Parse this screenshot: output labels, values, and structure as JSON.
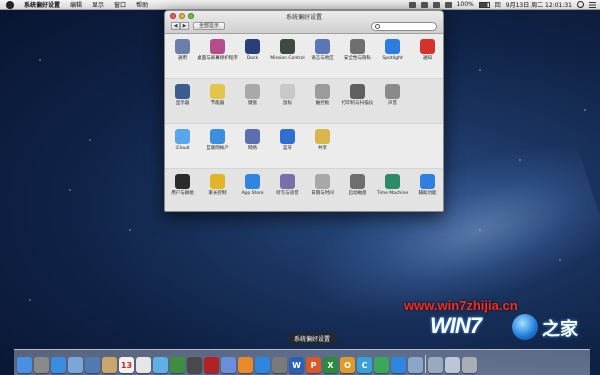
{
  "menubar": {
    "app_name": "系统偏好设置",
    "items": [
      "编辑",
      "显示",
      "窗口",
      "帮助"
    ],
    "battery": "100%",
    "clock": "9月13日 周二 12:01:31",
    "input_method": "回"
  },
  "window": {
    "title": "系统偏好设置",
    "show_all": "全部显示",
    "search_placeholder": "",
    "rows": [
      {
        "prefs": [
          {
            "label": "通用",
            "icon": "general-icon",
            "color": "#6b7da8"
          },
          {
            "label": "桌面与屏幕保护程序",
            "icon": "desktop-icon",
            "color": "#b54c8c"
          },
          {
            "label": "Dock",
            "icon": "dock-icon",
            "color": "#2a3f7a"
          },
          {
            "label": "Mission Control",
            "icon": "mission-control-icon",
            "color": "#3d4b3e"
          },
          {
            "label": "语言与地区",
            "icon": "language-region-icon",
            "color": "#5a76b8"
          },
          {
            "label": "安全性与隐私",
            "icon": "security-icon",
            "color": "#6f6f6f"
          },
          {
            "label": "Spotlight",
            "icon": "spotlight-icon",
            "color": "#2d7de0"
          },
          {
            "label": "通知",
            "icon": "notifications-icon",
            "color": "#d6322a"
          }
        ]
      },
      {
        "prefs": [
          {
            "label": "显示器",
            "icon": "display-icon",
            "color": "#3b5c8f"
          },
          {
            "label": "节能器",
            "icon": "energy-saver-icon",
            "color": "#e3c54a"
          },
          {
            "label": "键盘",
            "icon": "keyboard-icon",
            "color": "#a9a9a9"
          },
          {
            "label": "鼠标",
            "icon": "mouse-icon",
            "color": "#c8c8c8"
          },
          {
            "label": "触控板",
            "icon": "trackpad-icon",
            "color": "#9b9b9b"
          },
          {
            "label": "打印机与扫描仪",
            "icon": "printer-icon",
            "color": "#5f5f5f"
          },
          {
            "label": "声音",
            "icon": "sound-icon",
            "color": "#8a8a8a"
          }
        ]
      },
      {
        "prefs": [
          {
            "label": "iCloud",
            "icon": "icloud-icon",
            "color": "#5aa6ec"
          },
          {
            "label": "互联网帐户",
            "icon": "internet-accounts-icon",
            "color": "#3c8ee0"
          },
          {
            "label": "网络",
            "icon": "network-icon",
            "color": "#5b6fb0"
          },
          {
            "label": "蓝牙",
            "icon": "bluetooth-icon",
            "color": "#2f6fd0"
          },
          {
            "label": "共享",
            "icon": "sharing-icon",
            "color": "#d9b54a"
          }
        ]
      },
      {
        "prefs": [
          {
            "label": "用户与群组",
            "icon": "users-groups-icon",
            "color": "#2b2b2b"
          },
          {
            "label": "家长控制",
            "icon": "parental-controls-icon",
            "color": "#e0b526"
          },
          {
            "label": "App Store",
            "icon": "app-store-icon",
            "color": "#2f86e0"
          },
          {
            "label": "听写与语音",
            "icon": "dictation-speech-icon",
            "color": "#7a6fa8"
          },
          {
            "label": "日期与时间",
            "icon": "date-time-icon",
            "color": "#a8a8a8"
          },
          {
            "label": "启动磁盘",
            "icon": "startup-disk-icon",
            "color": "#6e6e6e"
          },
          {
            "label": "Time Machine",
            "icon": "time-machine-icon",
            "color": "#2f8a6a"
          },
          {
            "label": "辅助功能",
            "icon": "accessibility-icon",
            "color": "#2f7fe0"
          }
        ]
      }
    ]
  },
  "watermark": {
    "url": "www.win7zhijia.cn",
    "logo_text": "WIN7",
    "logo_suffix": "之家"
  },
  "dock": {
    "tooltip": "系统偏好设置",
    "icons": [
      {
        "name": "finder-icon",
        "color": "#4a90e2",
        "glyph": ""
      },
      {
        "name": "launchpad-icon",
        "color": "#8a8a8a",
        "glyph": ""
      },
      {
        "name": "safari-icon",
        "color": "#3a8de0",
        "glyph": ""
      },
      {
        "name": "mail-icon",
        "color": "#7aa6d8",
        "glyph": ""
      },
      {
        "name": "photo-icon",
        "color": "#4f7bb0",
        "glyph": ""
      },
      {
        "name": "notes-icon",
        "color": "#c9a66b",
        "glyph": ""
      },
      {
        "name": "calendar-icon",
        "color": "#f2f2f2",
        "glyph": "13"
      },
      {
        "name": "reminders-icon",
        "color": "#e6e6e6",
        "glyph": ""
      },
      {
        "name": "messages-icon",
        "color": "#5fb0e8",
        "glyph": ""
      },
      {
        "name": "facetime-icon",
        "color": "#3d8f3d",
        "glyph": ""
      },
      {
        "name": "camera-icon",
        "color": "#4a4a4a",
        "glyph": ""
      },
      {
        "name": "photo-booth-icon",
        "color": "#b22222",
        "glyph": ""
      },
      {
        "name": "itunes-icon",
        "color": "#6a8fd8",
        "glyph": ""
      },
      {
        "name": "ibooks-icon",
        "color": "#e88a2a",
        "glyph": ""
      },
      {
        "name": "app-store-dock-icon",
        "color": "#2f86e0",
        "glyph": ""
      },
      {
        "name": "system-preferences-icon",
        "color": "#7a7a7a",
        "glyph": ""
      },
      {
        "name": "word-icon",
        "color": "#2b5fb8",
        "glyph": "W"
      },
      {
        "name": "powerpoint-icon",
        "color": "#d85a2a",
        "glyph": "P"
      },
      {
        "name": "excel-icon",
        "color": "#2b8a3e",
        "glyph": "X"
      },
      {
        "name": "outlook-icon",
        "color": "#e09a2a",
        "glyph": "O"
      },
      {
        "name": "communicator-icon",
        "color": "#3aa0d8",
        "glyph": "C"
      },
      {
        "name": "messenger-icon",
        "color": "#3aa85a",
        "glyph": ""
      },
      {
        "name": "network-globe-icon",
        "color": "#2f86e0",
        "glyph": ""
      },
      {
        "name": "preview-icon",
        "color": "#8aa6c8",
        "glyph": ""
      },
      {
        "name": "downloads-icon",
        "color": "#9aa8c0",
        "glyph": ""
      },
      {
        "name": "documents-icon",
        "color": "#bcc6d6",
        "glyph": ""
      },
      {
        "name": "trash-icon",
        "color": "#a9aeb6",
        "glyph": ""
      }
    ]
  }
}
